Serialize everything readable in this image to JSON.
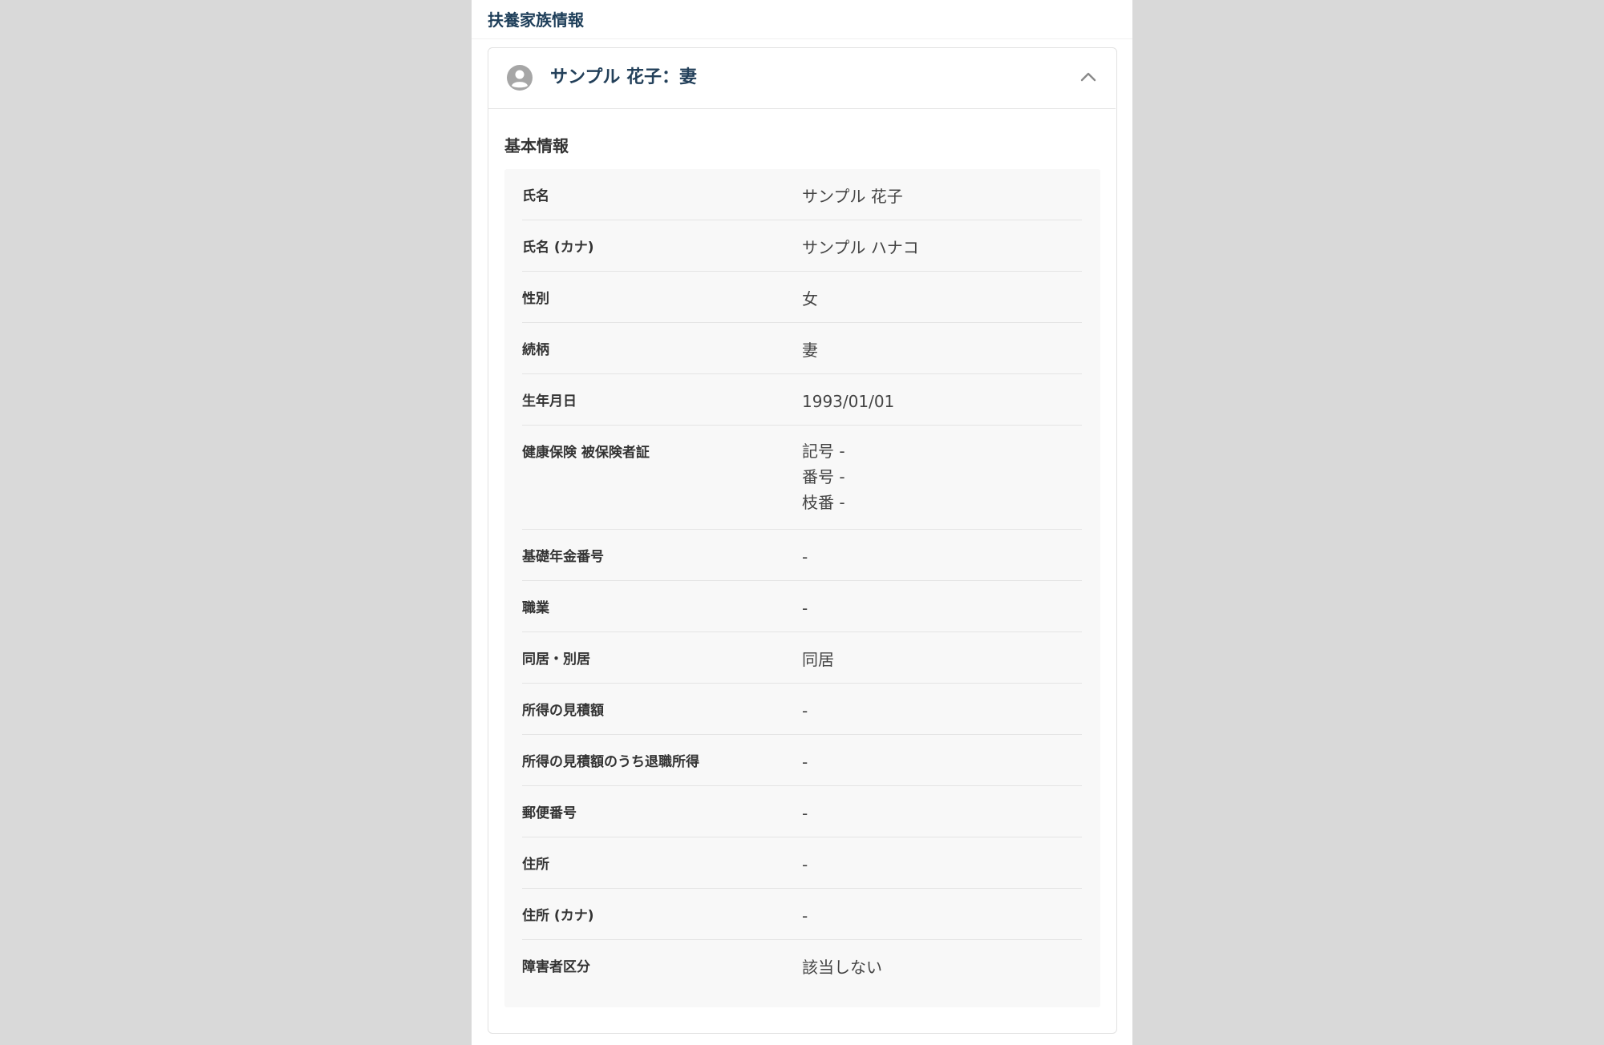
{
  "section": {
    "title": "扶養家族情報"
  },
  "dependent": {
    "header_title": "サンプル 花子：妻",
    "avatar_icon": "person-circle-icon",
    "toggle_icon": "chevron-up-icon"
  },
  "basic_info": {
    "title": "基本情報",
    "rows": [
      {
        "label": "氏名",
        "value": "サンプル 花子"
      },
      {
        "label": "氏名 (カナ)",
        "value": "サンプル ハナコ"
      },
      {
        "label": "性別",
        "value": "女"
      },
      {
        "label": "続柄",
        "value": "妻"
      },
      {
        "label": "生年月日",
        "value": "1993/01/01"
      },
      {
        "label": "健康保険 被保険者証",
        "lines": [
          "記号 -",
          "番号 -",
          "枝番 -"
        ]
      },
      {
        "label": "基礎年金番号",
        "value": "-"
      },
      {
        "label": "職業",
        "value": "-"
      },
      {
        "label": "同居・別居",
        "value": "同居"
      },
      {
        "label": "所得の見積額",
        "value": "-"
      },
      {
        "label": "所得の見積額のうち退職所得",
        "value": "-"
      },
      {
        "label": "郵便番号",
        "value": "-"
      },
      {
        "label": "住所",
        "value": "-"
      },
      {
        "label": "住所 (カナ)",
        "value": "-"
      },
      {
        "label": "障害者区分",
        "value": "該当しない"
      }
    ]
  },
  "colors": {
    "page_background": "#d9d9d9",
    "panel_background": "#f8f8f8",
    "title_text": "#1f3f5a",
    "divider": "#e4e4e4"
  }
}
